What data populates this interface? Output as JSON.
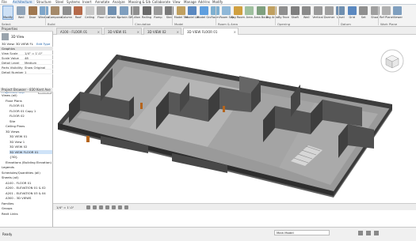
{
  "ribbon_tabs": [
    "File",
    "Architecture",
    "Structure",
    "Steel",
    "Systems",
    "Insert",
    "Annotate",
    "Analyze",
    "Massing & Site",
    "Collaborate",
    "View",
    "Manage",
    "Add-Ins",
    "Modify"
  ],
  "ribbon": {
    "buttons": [
      "Modify",
      "Wall",
      "Door",
      "Window",
      "Component",
      "Column",
      "Roof",
      "Ceiling",
      "Floor",
      "Curtain System",
      "Curtain Grid",
      "Mullion",
      "Railing",
      "Ramp",
      "Stair",
      "Model Text",
      "Model Line",
      "Model Group",
      "Room",
      "Room Separator",
      "Tag Room",
      "Area",
      "Area Boundary",
      "Tag Area",
      "By Face",
      "Shaft",
      "Wall",
      "Vertical",
      "Dormer",
      "Level",
      "Grid",
      "Set",
      "Show",
      "Ref Plane",
      "Viewer"
    ],
    "groups": [
      "Select",
      "Build",
      "Circulation",
      "Model",
      "Room & Area",
      "Opening",
      "Datum",
      "Work Plane"
    ]
  },
  "properties": {
    "title": "Properties",
    "type_name": "3D View",
    "filter": "3D View: 3D VIEW FLOOF",
    "edit_type": "Edit Type",
    "section": "Graphics",
    "rows": [
      {
        "k": "View Scale",
        "v": "1/4\" = 1'-0\""
      },
      {
        "k": "Scale Value",
        "v": "48"
      },
      {
        "k": "Detail Level",
        "v": "Medium"
      },
      {
        "k": "Parts Visibility",
        "v": "Show Original"
      },
      {
        "k": "Detail Number",
        "v": "1"
      }
    ],
    "help_link": "Properties help",
    "apply": "Apply"
  },
  "browser": {
    "title": "Project Browser - 830 Kent Ave",
    "items": [
      {
        "label": "Views (all)",
        "indent": 0
      },
      {
        "label": "Floor Plans",
        "indent": 1
      },
      {
        "label": "FLOOR 01",
        "indent": 2
      },
      {
        "label": "FLOOR 01 Copy 1",
        "indent": 2
      },
      {
        "label": "FLOOR 02",
        "indent": 2
      },
      {
        "label": "Site",
        "indent": 2
      },
      {
        "label": "Ceiling Plans",
        "indent": 1
      },
      {
        "label": "3D Views",
        "indent": 1
      },
      {
        "label": "3D VIEW 01",
        "indent": 2
      },
      {
        "label": "3D View 1",
        "indent": 2
      },
      {
        "label": "3D VIEW 02",
        "indent": 2
      },
      {
        "label": "3D VIEW FLOOR 01",
        "indent": 2,
        "selected": true
      },
      {
        "label": "{3D}",
        "indent": 2
      },
      {
        "label": "Elevations (Building Elevation)",
        "indent": 1
      },
      {
        "label": "Legends",
        "indent": 0
      },
      {
        "label": "Schedules/Quantities (all)",
        "indent": 0
      },
      {
        "label": "Sheets (all)",
        "indent": 0
      },
      {
        "label": "A100 - FLOOR 01",
        "indent": 1
      },
      {
        "label": "A200 - ELEVATION 01 & 02",
        "indent": 1
      },
      {
        "label": "A201 - ELEVATION 03 & 04",
        "indent": 1
      },
      {
        "label": "A300 - 3D VIEWS",
        "indent": 1
      },
      {
        "label": "Families",
        "indent": 0
      },
      {
        "label": "Groups",
        "indent": 0
      },
      {
        "label": "Revit Links",
        "indent": 0
      }
    ]
  },
  "view_tabs": [
    {
      "label": "A100 - FLOOR 01",
      "active": false
    },
    {
      "label": "3D VIEW 01",
      "active": false
    },
    {
      "label": "3D VIEW 02",
      "active": false
    },
    {
      "label": "3D VIEW FLOOR 01",
      "active": true
    }
  ],
  "view_bar": {
    "scale": "1/4\" = 1'-0\""
  },
  "status": {
    "text": "Ready",
    "scale_field": "Main Model"
  },
  "colors": {
    "ribbon_active": "#1b5fa8",
    "selection": "#cfe3f8",
    "wall_top": "#5a5a5a",
    "wall_side": "#4a4a4a",
    "floor": "#8c8c8c"
  }
}
